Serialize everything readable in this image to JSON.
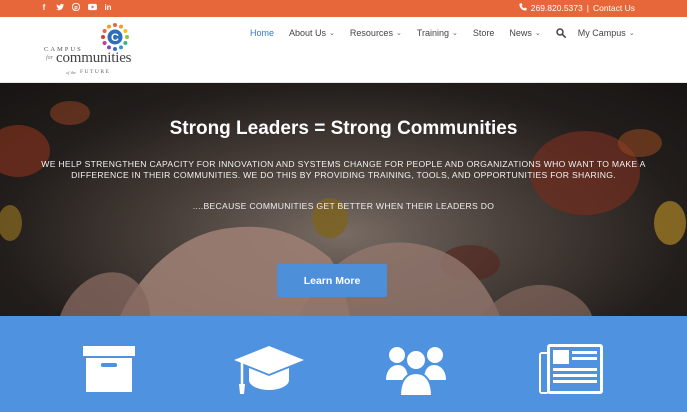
{
  "topbar": {
    "social": [
      {
        "icon": "facebook-icon",
        "glyph": "f"
      },
      {
        "icon": "twitter-icon",
        "glyph": "t"
      },
      {
        "icon": "pinterest-icon",
        "glyph": "p"
      },
      {
        "icon": "youtube-icon",
        "glyph": "▶"
      },
      {
        "icon": "linkedin-icon",
        "glyph": "in"
      }
    ],
    "phone": "269.820.5373",
    "separator": "|",
    "contact_label": "Contact Us",
    "bg_color": "#e7673a"
  },
  "logo": {
    "campus": "CAMPUS",
    "for": "for",
    "communities": "communities",
    "of_the": "of the",
    "future": "FUTURE",
    "letter": "C"
  },
  "nav": {
    "items": [
      {
        "label": "Home",
        "active": true,
        "dropdown": false
      },
      {
        "label": "About Us",
        "active": false,
        "dropdown": true
      },
      {
        "label": "Resources",
        "active": false,
        "dropdown": true
      },
      {
        "label": "Training",
        "active": false,
        "dropdown": true
      },
      {
        "label": "Store",
        "active": false,
        "dropdown": false
      },
      {
        "label": "News",
        "active": false,
        "dropdown": true
      }
    ],
    "my_campus": "My Campus",
    "active_color": "#3a78c9"
  },
  "hero": {
    "title": "Strong Leaders = Strong Communities",
    "description": "WE HELP STRENGTHEN CAPACITY FOR INNOVATION AND SYSTEMS CHANGE FOR PEOPLE AND ORGANIZATIONS WHO WANT TO MAKE A DIFFERENCE IN THEIR COMMUNITIES. WE DO THIS BY PROVIDING TRAINING, TOOLS, AND OPPORTUNITIES FOR SHARING.",
    "tagline": "....BECAUSE COMMUNITIES GET BETTER WHEN THEIR LEADERS DO",
    "button_label": "Learn More",
    "button_color": "#4e8fd9"
  },
  "features": {
    "bg_color": "#4e92e0",
    "icons": [
      "archive-box-icon",
      "graduation-cap-icon",
      "users-group-icon",
      "newspaper-icon"
    ]
  }
}
